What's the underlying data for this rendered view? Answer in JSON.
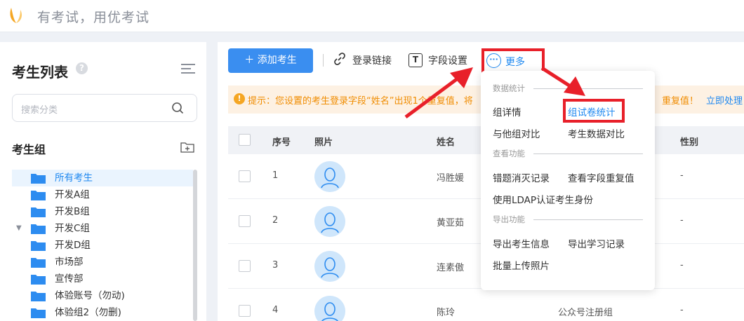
{
  "header": {
    "title": "有考试，用优考试"
  },
  "sidebar": {
    "title": "考生列表",
    "search_placeholder": "搜索分类",
    "group_title": "考生组",
    "tree": [
      {
        "label": "所有考生",
        "active": true
      },
      {
        "label": "开发A组"
      },
      {
        "label": "开发B组"
      },
      {
        "label": "开发C组",
        "expandable": true
      },
      {
        "label": "开发D组"
      },
      {
        "label": "市场部"
      },
      {
        "label": "宣传部"
      },
      {
        "label": "体验账号（勿动)"
      },
      {
        "label": "体验组2（勿删)"
      }
    ]
  },
  "toolbar": {
    "add_label": "添加考生",
    "login_link_label": "登录链接",
    "field_settings_label": "字段设置",
    "t_glyph": "T",
    "more_label": "更多"
  },
  "notice": {
    "text": "提示：您设置的考生登录字段“姓名”出现1个重复值，将",
    "text_end": "重复值！",
    "action": "立即处理"
  },
  "table": {
    "headers": {
      "index": "序号",
      "photo": "照片",
      "name": "姓名",
      "gender": "性别"
    },
    "rows": [
      {
        "index": "1",
        "name": "冯胜媛",
        "group": "",
        "gender": "-"
      },
      {
        "index": "2",
        "name": "黄亚茹",
        "group": "",
        "gender": "-"
      },
      {
        "index": "3",
        "name": "连素傲",
        "group": "",
        "gender": "-"
      },
      {
        "index": "4",
        "name": "陈玲",
        "group": "公众号注册组",
        "gender": "-"
      }
    ]
  },
  "dropdown": {
    "section_stats": "数据统计",
    "group_detail": "组详情",
    "group_paper_stats": "组试卷统计",
    "compare_groups": "与他组对比",
    "compare_data": "考生数据对比",
    "section_view": "查看功能",
    "error_records": "错题消灭记录",
    "view_duplicates": "查看字段重复值",
    "ldap_auth": "使用LDAP认证考生身份",
    "section_export": "导出功能",
    "export_info": "导出考生信息",
    "export_records": "导出学习记录",
    "batch_upload": "批量上传照片"
  },
  "colors": {
    "accent": "#1e88f0",
    "primary_button": "#3a8ef0",
    "annotation": "#e8202a",
    "notice": "#f08c00"
  }
}
